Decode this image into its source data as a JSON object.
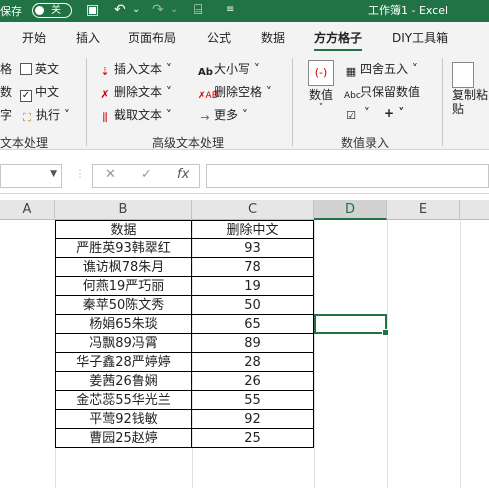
{
  "titlebar": {
    "autosave_label": "保存",
    "toggle_state": "关",
    "window_title": "工作簿1  -  Excel",
    "accent": "#217346"
  },
  "tabs": [
    "开始",
    "插入",
    "页面布局",
    "公式",
    "数据",
    "方方格子",
    "DIY工具箱"
  ],
  "active_tab": "方方格子",
  "ribbon": {
    "left_partial": {
      "row1_stub": "格",
      "row2_stub": "数",
      "row3_stub": "字",
      "english": "英文",
      "chinese": "中文",
      "execute": "执行",
      "group_stub": "文本处理"
    },
    "text_group": {
      "insert_text": "插入文本",
      "delete_text": "删除文本",
      "extract_text": "截取文本",
      "case": "大小写",
      "delete_space": "删除空格",
      "more": "更多",
      "group_label": "高级文本处理"
    },
    "value_group": {
      "value_btn": "数值",
      "round": "四舍五入",
      "keep_value": "只保留数值",
      "group_label": "数值录入"
    },
    "paste_group": {
      "paste_btn": "复制粘贴"
    }
  },
  "formulabar": {
    "fx_label": "fx",
    "cancel_icon": "✕",
    "confirm_icon": "✓"
  },
  "columns": [
    "A",
    "B",
    "C",
    "D",
    "E"
  ],
  "selected_column": "D",
  "table": {
    "headers": [
      "数据",
      "删除中文"
    ],
    "rows": [
      [
        "严胜英93韩翠红",
        "93"
      ],
      [
        "谯访枫78朱月",
        "78"
      ],
      [
        "何燕19严巧丽",
        "19"
      ],
      [
        "秦苹50陈文秀",
        "50"
      ],
      [
        "杨娟65朱琰",
        "65"
      ],
      [
        "冯飘89冯霄",
        "89"
      ],
      [
        "华子鑫28严婷婷",
        "28"
      ],
      [
        "姜茜26鲁娴",
        "26"
      ],
      [
        "金芯蕊55华光兰",
        "55"
      ],
      [
        "平莺92钱敏",
        "92"
      ],
      [
        "曹园25赵婷",
        "25"
      ]
    ]
  }
}
